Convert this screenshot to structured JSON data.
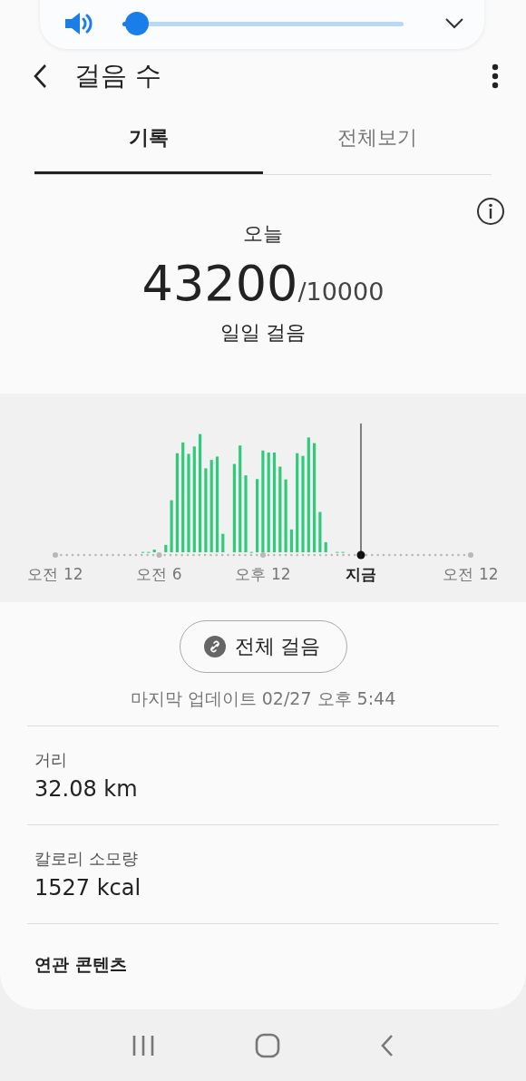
{
  "volume": {
    "level": 0.05
  },
  "header": {
    "title": "걸음 수"
  },
  "tabs": [
    {
      "label": "기록",
      "selected": true
    },
    {
      "label": "전체보기",
      "selected": false
    }
  ],
  "today": {
    "label": "오늘",
    "steps": "43200",
    "goal": "/10000",
    "caption": "일일 걸음"
  },
  "chart": {
    "axis_labels": [
      {
        "text": "오전 12",
        "kind": "time"
      },
      {
        "text": "오전 6",
        "kind": "time"
      },
      {
        "text": "오후 12",
        "kind": "time"
      },
      {
        "text": "지금",
        "kind": "now"
      },
      {
        "text": "오전 12",
        "kind": "time"
      }
    ]
  },
  "all_steps_button": "전체 걸음",
  "last_update": "마지막 업데이트 02/27 오후 5:44",
  "stats": [
    {
      "label": "거리",
      "value": "32.08 km"
    },
    {
      "label": "칼로리 소모량",
      "value": "1527 kcal"
    }
  ],
  "related_heading": "연관 콘텐츠"
}
